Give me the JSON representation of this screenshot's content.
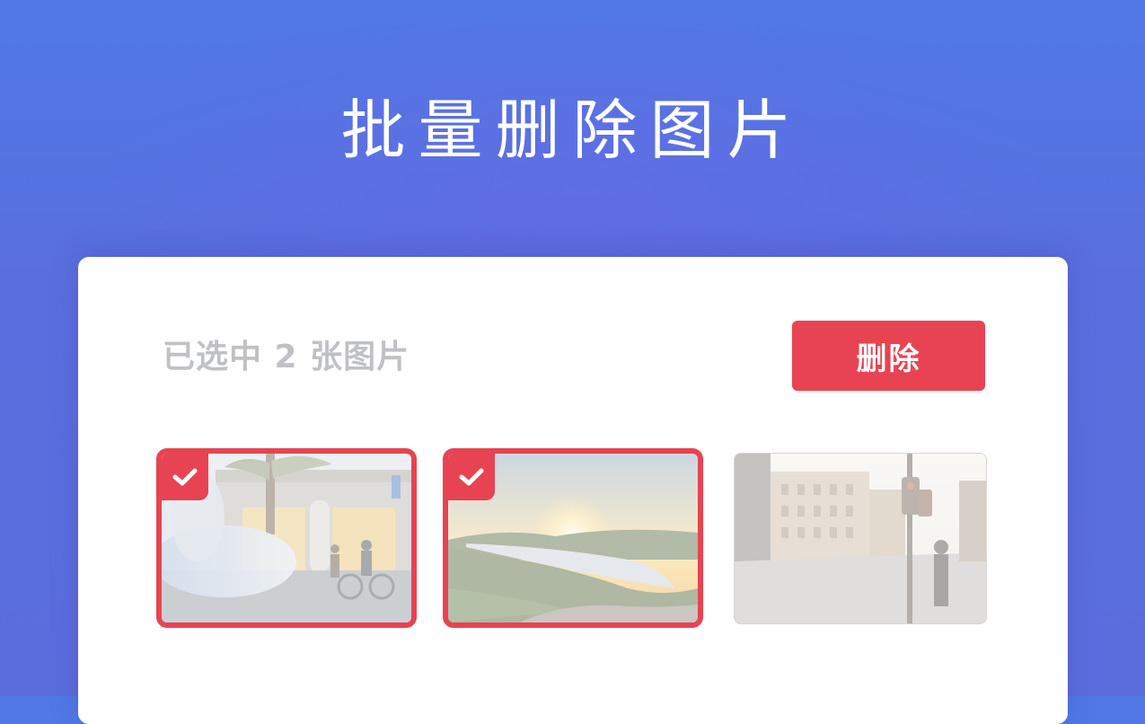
{
  "page": {
    "title": "批量删除图片"
  },
  "toolbar": {
    "selected_text": "已选中 2 张图片",
    "delete_label": "删除"
  },
  "gallery": {
    "images": [
      {
        "name": "street-cyclists-photo",
        "selected": true
      },
      {
        "name": "lake-sunset-photo",
        "selected": true
      },
      {
        "name": "city-street-photo",
        "selected": false
      }
    ]
  },
  "colors": {
    "accent": "#e84352",
    "background_top": "#5079e6",
    "background_bottom": "#5b6ddd",
    "muted_text": "#bfc1c5"
  },
  "icons": {
    "check": "check-icon"
  }
}
